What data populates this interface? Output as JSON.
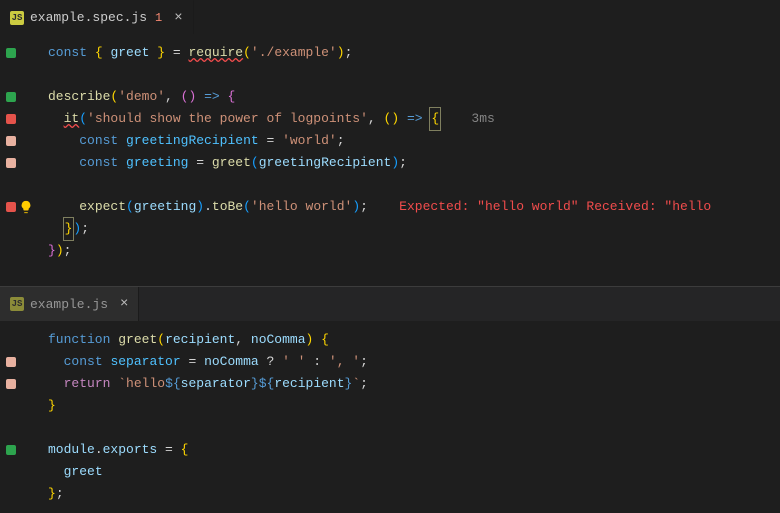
{
  "panes": {
    "top": {
      "tab": {
        "file": "example.spec.js",
        "badge": "1",
        "close": "×"
      },
      "hint_time": "3ms",
      "error_inline": "Expected: \"hello world\" Received: \"hello",
      "code": {
        "require_kw": "const",
        "greet_ident": "greet",
        "require_fn": "require",
        "require_path": "'./example'",
        "describe_fn": "describe",
        "describe_name": "'demo'",
        "it_fn": "it",
        "it_name": "'should show the power of logpoints'",
        "const_kw1": "const",
        "greetingRecipient": "greetingRecipient",
        "world": "'world'",
        "const_kw2": "const",
        "greeting": "greeting",
        "greet_call": "greet",
        "expect_fn": "expect",
        "toBe_fn": "toBe",
        "hello_world": "'hello world'"
      }
    },
    "bottom": {
      "tab": {
        "file": "example.js",
        "close": "×"
      },
      "code": {
        "function_kw": "function",
        "greet_fn": "greet",
        "recipient": "recipient",
        "noComma": "noComma",
        "const_kw": "const",
        "separator": "separator",
        "space": "' '",
        "comma_space": "', '",
        "return_kw": "return",
        "tmpl_hello": "hello",
        "module": "module",
        "exports": "exports",
        "greet_export": "greet"
      }
    }
  }
}
